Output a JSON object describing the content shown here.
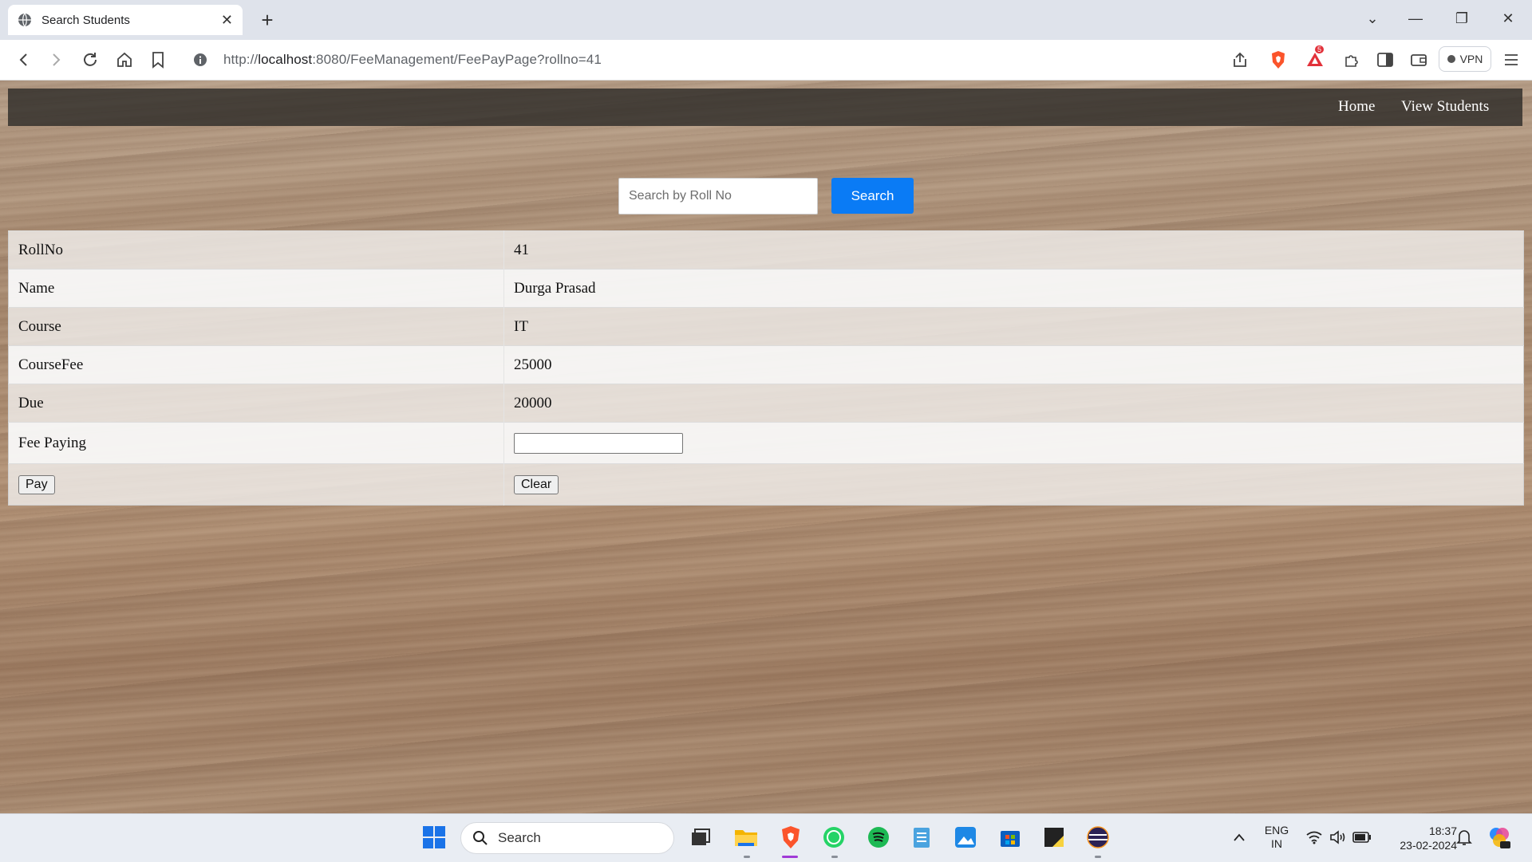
{
  "browser": {
    "tab_title": "Search Students",
    "url_prefix": "http://",
    "url_host": "localhost",
    "url_rest": ":8080/FeeManagement/FeePayPage?rollno=41",
    "vpn_label": "VPN",
    "brave_badge_count": "5"
  },
  "site_nav": {
    "home": "Home",
    "view_students": "View Students"
  },
  "search": {
    "placeholder": "Search by Roll No",
    "button_label": "Search"
  },
  "student": {
    "rows": [
      {
        "label": "RollNo",
        "value": "41"
      },
      {
        "label": "Name",
        "value": "Durga Prasad"
      },
      {
        "label": "Course",
        "value": "IT"
      },
      {
        "label": "CourseFee",
        "value": "25000"
      },
      {
        "label": "Due",
        "value": "20000"
      }
    ],
    "fee_label": "Fee Paying",
    "fee_value": "",
    "pay_label": "Pay",
    "clear_label": "Clear"
  },
  "taskbar": {
    "search_label": "Search",
    "lang_line1": "ENG",
    "lang_line2": "IN",
    "time": "18:37",
    "date": "23-02-2024"
  },
  "colors": {
    "search_button": "#0a7bf5",
    "nav_bar": "#2a2826"
  }
}
